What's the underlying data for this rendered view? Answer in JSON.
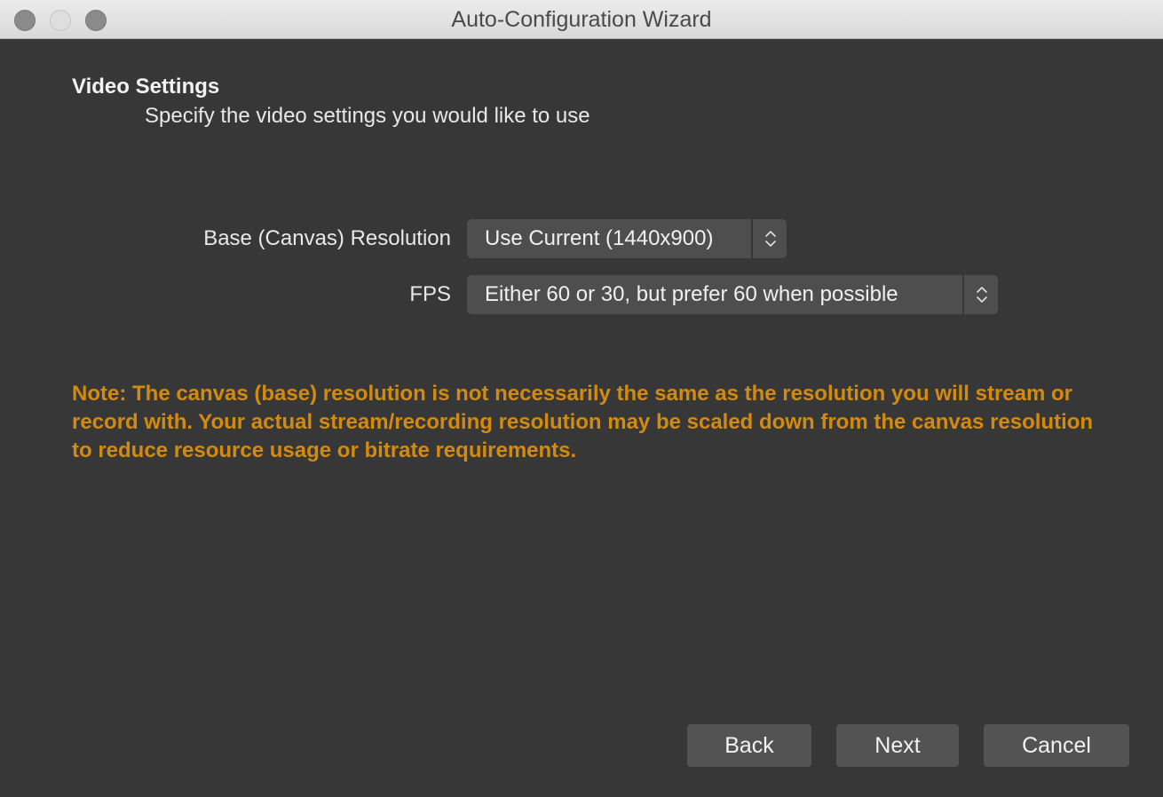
{
  "window": {
    "title": "Auto-Configuration Wizard"
  },
  "page": {
    "heading": "Video Settings",
    "subheading": "Specify the video settings you would like to use"
  },
  "fields": {
    "resolution": {
      "label": "Base (Canvas) Resolution",
      "value": "Use Current (1440x900)"
    },
    "fps": {
      "label": "FPS",
      "value": "Either 60 or 30, but prefer 60 when possible"
    }
  },
  "note": "Note: The canvas (base) resolution is not necessarily the same as the resolution you will stream or record with. Your actual stream/recording resolution may be scaled down from the canvas resolution to reduce resource usage or bitrate requirements.",
  "buttons": {
    "back": "Back",
    "next": "Next",
    "cancel": "Cancel"
  },
  "colors": {
    "window_background": "#373737",
    "note_text": "#d28a0f",
    "control_background": "#4e4e4e"
  },
  "icons": {
    "stepper": "chevron-up-down-icon"
  }
}
